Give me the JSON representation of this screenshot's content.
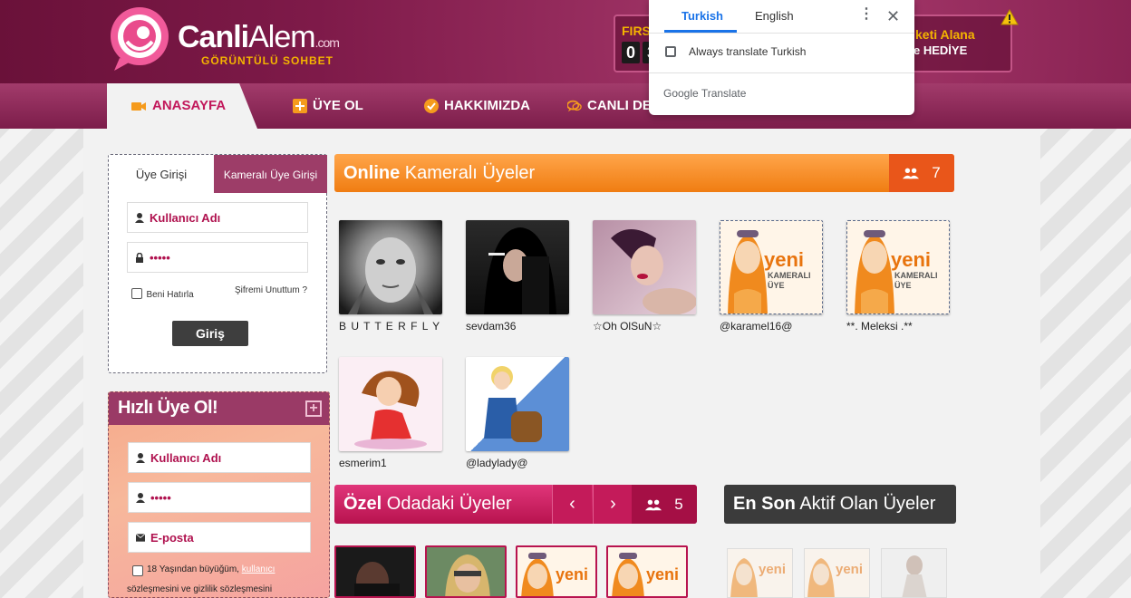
{
  "header": {
    "logo_main": "Canli",
    "logo_alem": "Alem",
    "logo_com": ".com",
    "logo_sub": "GÖRÜNTÜLÜ SOHBET",
    "promo_left": "FIRSA",
    "counter_digits": [
      "0",
      "3"
    ],
    "promo_right_1": "keti Alana",
    "promo_right_2": "e HEDİYE",
    "warning_icon": "warning-icon"
  },
  "nav": {
    "items": [
      {
        "label": "ANASAYFA",
        "icon": "camera-icon"
      },
      {
        "label": "ÜYE OL",
        "icon": "plus-square-icon"
      },
      {
        "label": "HAKKIMIZDA",
        "icon": "check-circle-icon"
      },
      {
        "label": "CANLI DE",
        "icon": "chat-icon"
      }
    ]
  },
  "login": {
    "tab_member": "Üye Girişi",
    "tab_camera": "Kameralı Üye Girişi",
    "username_placeholder": "Kullanıcı Adı",
    "password_value": "•••••",
    "remember_label": "Beni Hatırla",
    "forgot_label": "Şifremi Unuttum ?",
    "submit_label": "Giriş"
  },
  "quick_register": {
    "title": "Hızlı Üye Ol!",
    "username_placeholder": "Kullanıcı Adı",
    "password_value": "•••••",
    "email_placeholder": "E-posta",
    "terms_text": "18 Yaşından büyüğüm,",
    "terms_link": "kullanıcı",
    "terms_text_2": "sözleşmesini ve gizlilik sözleşmesini"
  },
  "online": {
    "title_bold": "Online",
    "title_rest": " Kameralı Üyeler",
    "count": "7",
    "members": [
      {
        "name": "B U T T E R F L Y"
      },
      {
        "name": "sevdam36"
      },
      {
        "name": "☆Oh OlSuN☆"
      },
      {
        "name": "@karamel16@"
      },
      {
        "name": "**. Meleksi .**"
      },
      {
        "name": "esmerim1"
      },
      {
        "name": "@ladylady@"
      }
    ]
  },
  "yeni_badge": {
    "word": "yeni",
    "line1": "KAMERALI",
    "line2": "ÜYE"
  },
  "private_rooms": {
    "title_bold": "Özel",
    "title_rest": " Odadaki Üyeler",
    "prev": "‹",
    "next": "›",
    "count": "5"
  },
  "recent": {
    "title_bold": "En Son",
    "title_rest": " Aktif Olan Üyeler"
  },
  "translate_popup": {
    "tab_source": "Turkish",
    "tab_target": "English",
    "always_label": "Always translate Turkish",
    "brand": "Google Translate",
    "more": "⋮",
    "close": "✕"
  },
  "colors": {
    "brand": "#7e1a49",
    "accent_pink": "#c2185b",
    "orange": "#f07d12",
    "google_blue": "#1a73e8"
  }
}
